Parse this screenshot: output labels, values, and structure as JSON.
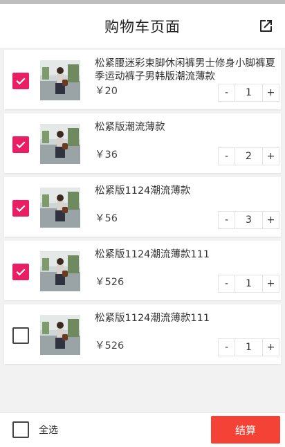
{
  "header": {
    "title": "购物车页面",
    "share_icon": "open-in-new-icon"
  },
  "colors": {
    "accent": "#e91e63",
    "checkout": "#f44336"
  },
  "items": [
    {
      "title": "松紧腰迷彩束脚休闲裤男士修身小脚裤夏季运动裤子男韩版潮流薄款",
      "price": "￥20",
      "qty": "1",
      "checked": true
    },
    {
      "title": "松紧版潮流薄款",
      "price": "￥36",
      "qty": "2",
      "checked": true
    },
    {
      "title": "松紧版1124潮流薄款",
      "price": "￥56",
      "qty": "3",
      "checked": true
    },
    {
      "title": "松紧版1124潮流薄款111",
      "price": "￥526",
      "qty": "1",
      "checked": true
    },
    {
      "title": "松紧版1124潮流薄款111",
      "price": "￥526",
      "qty": "1",
      "checked": false
    }
  ],
  "stepper": {
    "minus": "-",
    "plus": "+"
  },
  "footer": {
    "select_all_label": "全选",
    "checkout_label": "结算",
    "select_all_checked": false
  }
}
